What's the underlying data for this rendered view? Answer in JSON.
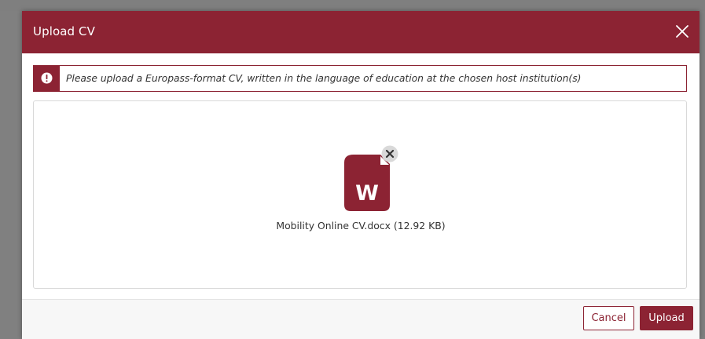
{
  "dialog": {
    "title": "Upload CV",
    "close_icon": "close-icon"
  },
  "notice": {
    "icon": "exclamation-icon",
    "text": "Please upload a Europass-format CV, written in the language of education at the chosen host institution(s)"
  },
  "file": {
    "icon": "word-document-icon",
    "icon_letter": "W",
    "remove_icon": "remove-file-icon",
    "name": "Mobility Online CV.docx (12.92 KB)"
  },
  "footer": {
    "cancel_label": "Cancel",
    "upload_label": "Upload"
  },
  "colors": {
    "brand": "#8c2333",
    "backdrop": "#808080",
    "text": "#333333"
  }
}
